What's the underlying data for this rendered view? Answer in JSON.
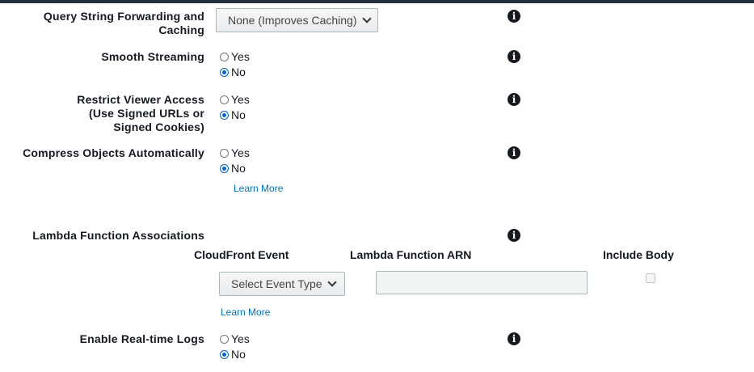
{
  "query_string": {
    "label": "Query String Forwarding and Caching",
    "selected_value": "None (Improves Caching)"
  },
  "smooth_streaming": {
    "label": "Smooth Streaming",
    "options": [
      "Yes",
      "No"
    ],
    "selected": "No"
  },
  "restrict_viewer_access": {
    "label": "Restrict Viewer Access (Use Signed URLs or Signed Cookies)",
    "options": [
      "Yes",
      "No"
    ],
    "selected": "No"
  },
  "compress_objects": {
    "label": "Compress Objects Automatically",
    "options": [
      "Yes",
      "No"
    ],
    "selected": "No",
    "learn_more": "Learn More"
  },
  "lambda_associations": {
    "label": "Lambda Function Associations",
    "headers": {
      "cloudfront_event": "CloudFront Event",
      "lambda_arn": "Lambda Function ARN",
      "include_body": "Include Body"
    },
    "event_select_value": "Select Event Type",
    "arn_value": "",
    "include_body_checked": false,
    "learn_more": "Learn More"
  },
  "realtime_logs": {
    "label": "Enable Real-time Logs",
    "options": [
      "Yes",
      "No"
    ],
    "selected": "No"
  },
  "icons": {
    "info": "info-icon",
    "dropdown": "chevron-down-icon"
  },
  "colors": {
    "link": "#0073bb",
    "radio_selected": "#0066cc",
    "top_bar": "#232f3e"
  }
}
